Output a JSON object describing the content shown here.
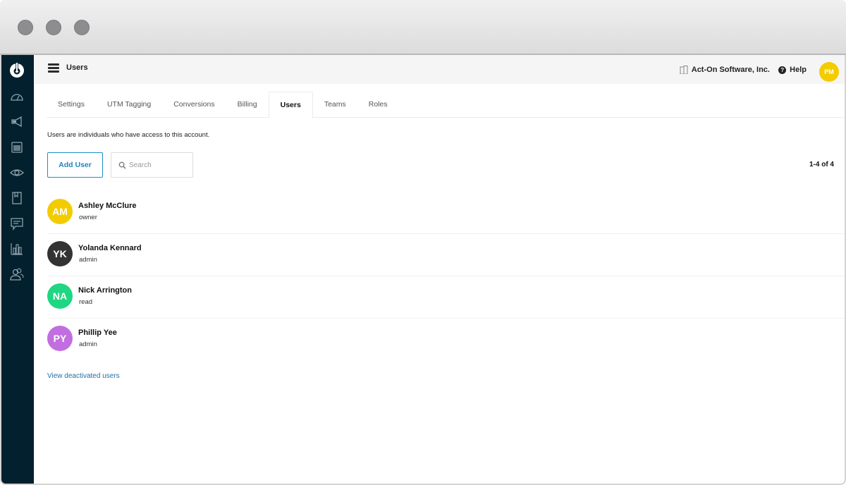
{
  "window": {
    "controls": [
      "close",
      "minimize",
      "maximize"
    ]
  },
  "sidebar": {
    "logo": "power-icon",
    "items": [
      {
        "icon": "dashboard-gauge-icon"
      },
      {
        "icon": "megaphone-icon"
      },
      {
        "icon": "calendar-icon"
      },
      {
        "icon": "eye-icon"
      },
      {
        "icon": "bookmark-book-icon"
      },
      {
        "icon": "chat-bubble-icon"
      },
      {
        "icon": "bar-chart-icon"
      },
      {
        "icon": "contacts-people-icon"
      }
    ],
    "background": "#02202d"
  },
  "header": {
    "title": "Users",
    "company": "Act-On Software, Inc.",
    "help_label": "Help",
    "avatar_initials": "PM",
    "avatar_color": "#f3cc00"
  },
  "tabs": [
    {
      "label": "Settings",
      "active": false
    },
    {
      "label": "UTM Tagging",
      "active": false
    },
    {
      "label": "Conversions",
      "active": false
    },
    {
      "label": "Billing",
      "active": false
    },
    {
      "label": "Users",
      "active": true
    },
    {
      "label": "Teams",
      "active": false
    },
    {
      "label": "Roles",
      "active": false
    }
  ],
  "main": {
    "description": "Users are individuals who have access to this account.",
    "add_user_label": "Add User",
    "search_placeholder": "Search",
    "search_value": "",
    "pagination": "1-4 of 4",
    "view_deactivated_label": "View deactivated users",
    "accent_color": "#1a85c4"
  },
  "users": [
    {
      "initials": "AM",
      "name": "Ashley McClure",
      "role": "owner",
      "color": "#f3cc00"
    },
    {
      "initials": "YK",
      "name": "Yolanda Kennard",
      "role": "admin",
      "color": "#333333"
    },
    {
      "initials": "NA",
      "name": "Nick Arrington",
      "role": "read",
      "color": "#1fd683"
    },
    {
      "initials": "PY",
      "name": "Phillip Yee",
      "role": "admin",
      "color": "#c16ee0"
    }
  ]
}
